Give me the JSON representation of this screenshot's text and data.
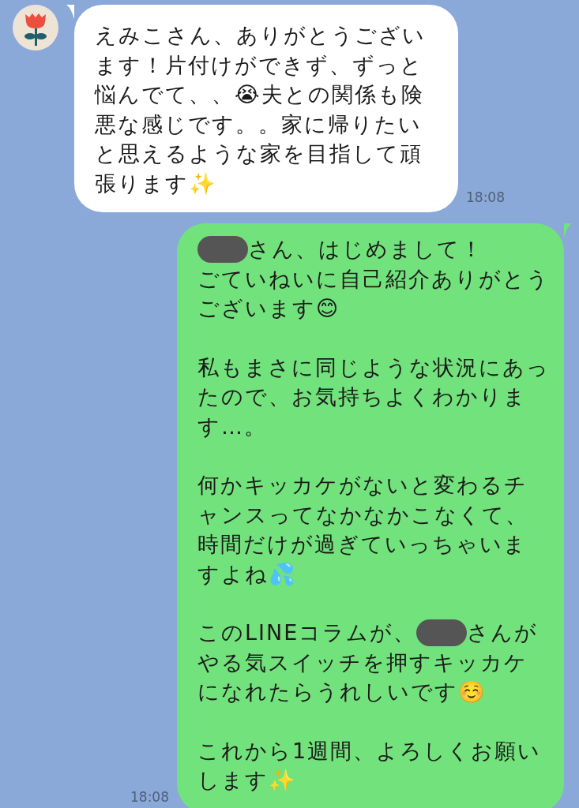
{
  "messages": [
    {
      "kind": "incoming",
      "time": "18:08",
      "paragraphs": [
        [
          [
            {
              "kind": "text",
              "text": "えみこさん、ありがとうございます！片付けができず、ずっと悩んでて、、😭夫との関係も険悪な感じです。。家に帰りたいと思えるような家を目指して頑張ります✨"
            }
          ]
        ]
      ]
    },
    {
      "kind": "outgoing",
      "time": "18:08",
      "paragraphs": [
        [
          [
            {
              "kind": "redaction"
            },
            {
              "kind": "text",
              "text": "さん、はじめまして！"
            }
          ],
          [
            {
              "kind": "text",
              "text": "ごていねいに自己紹介ありがとうございます😊"
            }
          ]
        ],
        [
          [
            {
              "kind": "text",
              "text": "私もまさに同じような状況にあったので、お気持ちよくわかります…。"
            }
          ]
        ],
        [
          [
            {
              "kind": "text",
              "text": "何かキッカケがないと変わるチャンスってなかなかこなくて、時間だけが過ぎていっちゃいますよね💦"
            }
          ]
        ],
        [
          [
            {
              "kind": "text",
              "text": "このLINEコラムが、"
            },
            {
              "kind": "redaction"
            },
            {
              "kind": "text",
              "text": "さんが"
            }
          ],
          [
            {
              "kind": "text",
              "text": "やる気スイッチを押すキッカケになれたらうれしいです☺️"
            }
          ]
        ],
        [
          [
            {
              "kind": "text",
              "text": "これから1週間、よろしくお願いします✨"
            }
          ]
        ]
      ]
    }
  ]
}
